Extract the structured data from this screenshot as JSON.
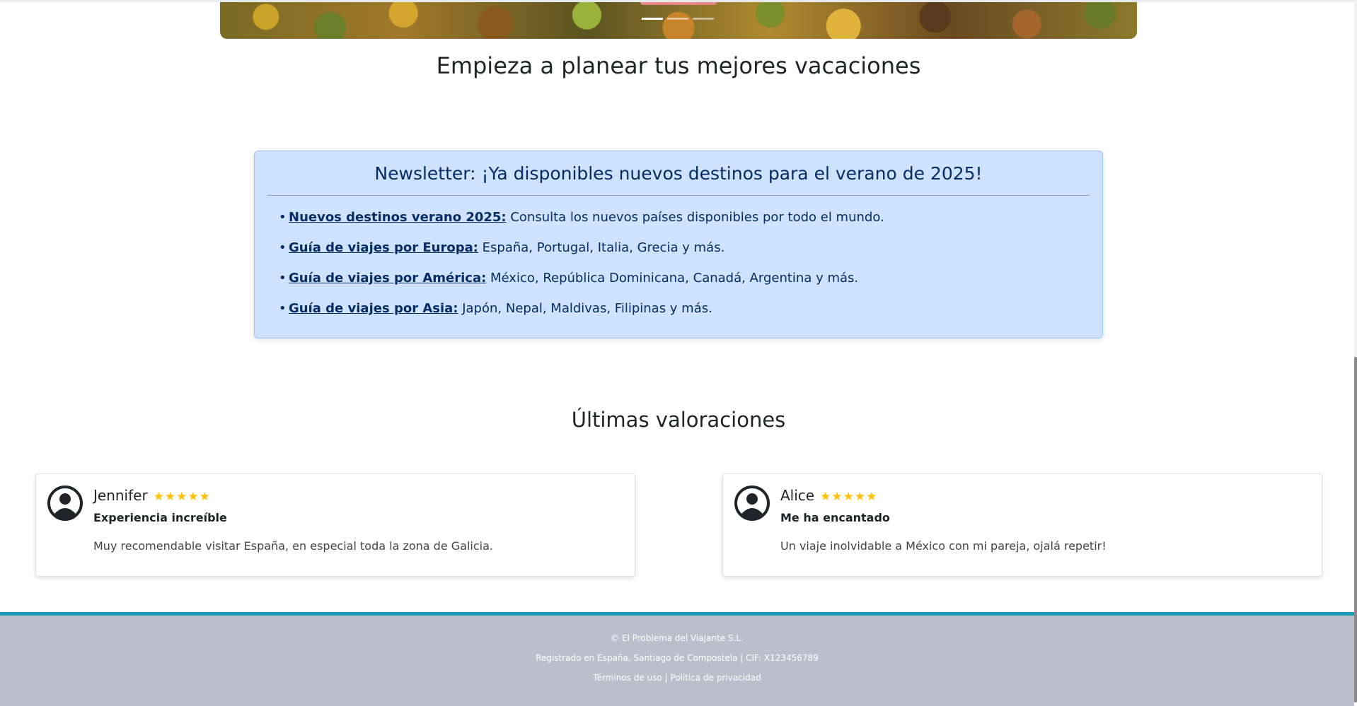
{
  "hero": {
    "heading": "Empieza a planear tus mejores vacaciones"
  },
  "newsletter": {
    "title": "Newsletter: ¡Ya disponibles nuevos destinos para el verano de 2025!",
    "items": [
      {
        "link": "Nuevos destinos verano 2025:",
        "text": " Consulta los nuevos países disponibles por todo el mundo."
      },
      {
        "link": "Guía de viajes por Europa:",
        "text": " España, Portugal, Italia, Grecia y más."
      },
      {
        "link": "Guía de viajes por América:",
        "text": " México, República Dominicana, Canadá, Argentina y más."
      },
      {
        "link": "Guía de viajes por Asia:",
        "text": " Japón, Nepal, Maldivas, Filipinas y más."
      }
    ]
  },
  "reviews": {
    "heading": "Últimas valoraciones",
    "items": [
      {
        "name": "Jennifer",
        "stars": "★★★★★",
        "rating": 5,
        "title": "Experiencia increíble",
        "text": "Muy recomendable visitar España, en especial toda la zona de Galicia."
      },
      {
        "name": "Alice",
        "stars": "★★★★★",
        "rating": 5,
        "title": "Me ha encantado",
        "text": "Un viaje inolvidable a México con mi pareja, ojalá repetir!"
      }
    ]
  },
  "footer": {
    "copyright": "© El Problema del Viajante S.L.",
    "registry": "Registrado en España, Santiago de Compostela | CIF: X123456789",
    "terms": "Términos de uso",
    "separator": " | ",
    "privacy": "Política de privacidad"
  },
  "carousel": {
    "slide_count": 3,
    "active_index": 0
  },
  "colors": {
    "newsletter_bg": "#cfe2ff",
    "newsletter_text": "#052c65",
    "star": "#ffc107",
    "footer_bg": "#bbbfcb",
    "footer_accent": "#1a9bb8"
  },
  "icons": {
    "avatar": "user-circle-icon",
    "star": "star-icon"
  }
}
